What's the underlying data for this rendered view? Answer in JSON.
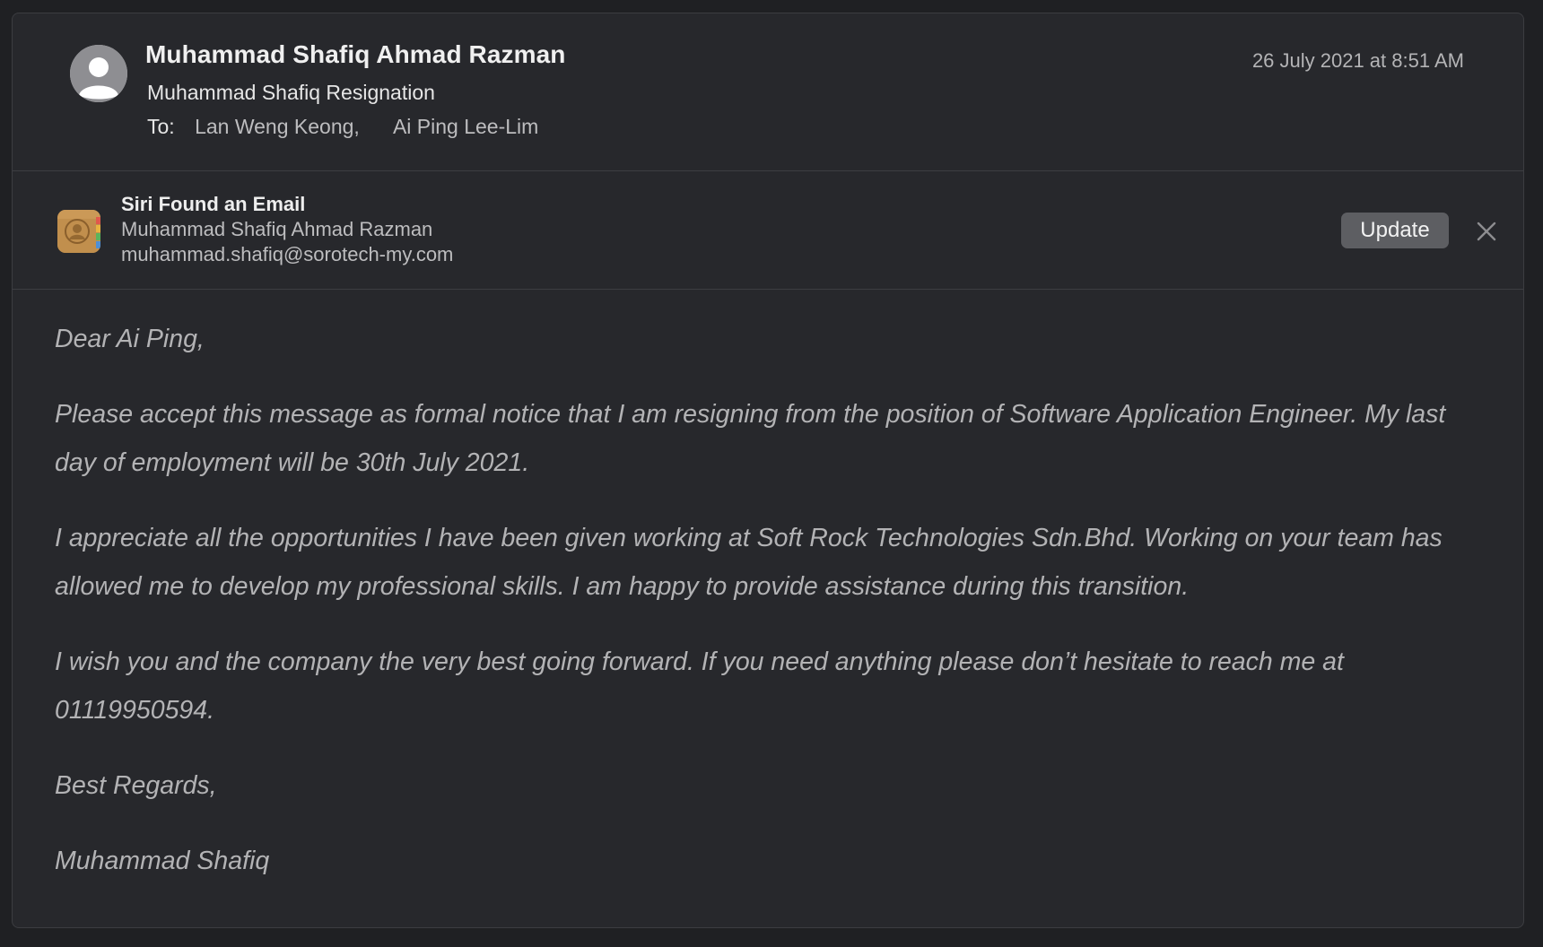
{
  "header": {
    "sender_name": "Muhammad Shafiq Ahmad Razman",
    "subject": "Muhammad Shafiq Resignation",
    "to_label": "To:",
    "recipients": [
      "Lan Weng Keong,",
      "Ai Ping Lee-Lim"
    ],
    "date": "26 July 2021 at 8:51 AM",
    "avatar_icon": "person-silhouette-icon"
  },
  "siri_banner": {
    "icon": "contacts-app-icon",
    "title": "Siri Found an Email",
    "contact_name": "Muhammad Shafiq Ahmad Razman",
    "contact_email": "muhammad.shafiq@sorotech-my.com",
    "update_label": "Update",
    "close_icon": "close-icon"
  },
  "message": {
    "greeting": "Dear Ai Ping,",
    "paragraphs": [
      "Please accept this message as formal notice that I am resigning from the position of Software Application Engineer. My last day of employment will be 30th July 2021.",
      "I appreciate all the opportunities I have been given working at Soft Rock Technologies Sdn.Bhd.  Working on your team has allowed me to develop my professional skills. I am happy to provide assistance during this transition.",
      "I wish you and the company the very best going forward. If you need anything please don’t hesitate to reach me at 01119950594."
    ],
    "closing": "Best Regards,",
    "signature": "Muhammad Shafiq"
  },
  "colors": {
    "background": "#1f2023",
    "panel": "#27282c",
    "body_text": "#b3b3b5",
    "button": "#5d5e62"
  }
}
